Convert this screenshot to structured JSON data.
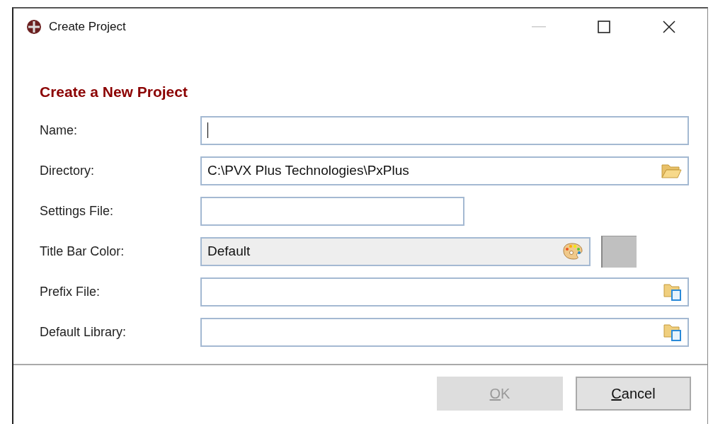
{
  "window": {
    "title": "Create Project"
  },
  "heading": "Create a New Project",
  "fields": [
    {
      "label": "Name:",
      "kind": "text",
      "focused": true,
      "wide": true
    },
    {
      "label": "Directory:",
      "kind": "folder",
      "value": "C:\\PVX Plus Technologies\\PxPlus",
      "focused": false,
      "wide": true
    },
    {
      "label": "Settings File:",
      "kind": "text",
      "focused": false,
      "wide": false
    },
    {
      "label": "Title Bar Color:",
      "kind": "color",
      "value": "Default",
      "focused": false,
      "wide": false,
      "color": "#c0c0c0"
    },
    {
      "label": "Prefix File:",
      "kind": "file",
      "focused": false,
      "wide": true
    },
    {
      "label": "Default Library:",
      "kind": "file",
      "focused": false,
      "wide": true
    }
  ],
  "buttons": [
    {
      "label": "OK",
      "disabled": true
    },
    {
      "label": "Cancel",
      "disabled": false
    }
  ]
}
